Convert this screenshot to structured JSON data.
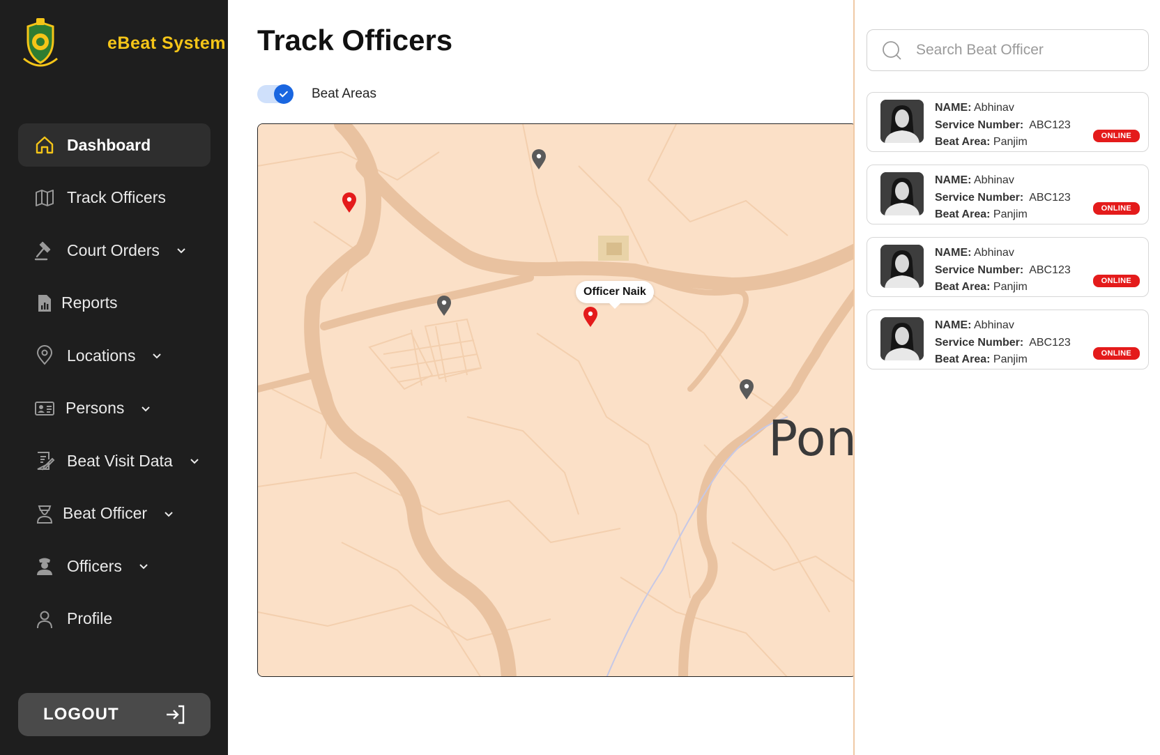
{
  "app": {
    "brand_title": "eBeat System",
    "brand_logo": "emblem-icon"
  },
  "sidebar": {
    "items": [
      {
        "label": "Dashboard",
        "icon": "home-icon",
        "active": true,
        "has_chevron": false
      },
      {
        "label": "Track Officers",
        "icon": "map-icon",
        "active": false,
        "has_chevron": false
      },
      {
        "label": "Court Orders",
        "icon": "gavel-icon",
        "active": false,
        "has_chevron": true
      },
      {
        "label": "Reports",
        "icon": "report-icon",
        "active": false,
        "has_chevron": false
      },
      {
        "label": "Locations",
        "icon": "location-icon",
        "active": false,
        "has_chevron": true
      },
      {
        "label": "Persons",
        "icon": "id-card-icon",
        "active": false,
        "has_chevron": true
      },
      {
        "label": "Beat Visit Data",
        "icon": "edit-document-icon",
        "active": false,
        "has_chevron": true
      },
      {
        "label": "Beat Officer",
        "icon": "officer-icon",
        "active": false,
        "has_chevron": true
      },
      {
        "label": "Officers",
        "icon": "police-icon",
        "active": false,
        "has_chevron": true
      },
      {
        "label": "Profile",
        "icon": "user-icon",
        "active": false,
        "has_chevron": false
      }
    ],
    "logout_label": "LOGOUT",
    "logout_icon": "logout-icon"
  },
  "main": {
    "title": "Track Officers",
    "toggle": {
      "label": "Beat Areas",
      "checked": true
    },
    "map": {
      "tooltip": "Officer Naik",
      "city_label": "Pon",
      "pins": [
        {
          "color": "#e41b1b",
          "kind": "officer"
        },
        {
          "color": "#5a5a5a",
          "kind": "location"
        },
        {
          "color": "#5a5a5a",
          "kind": "location"
        },
        {
          "color": "#e41b1b",
          "kind": "officer",
          "selected": true
        },
        {
          "color": "#5a5a5a",
          "kind": "location"
        }
      ]
    }
  },
  "panel": {
    "search_placeholder": "Search Beat Officer",
    "cards": [
      {
        "name_label": "NAME:",
        "name": "Abhinav",
        "service_label": "Service Number:",
        "service": "ABC123",
        "area_label": "Beat Area:",
        "area": "Panjim",
        "status": "ONLINE"
      },
      {
        "name_label": "NAME:",
        "name": "Abhinav",
        "service_label": "Service Number:",
        "service": "ABC123",
        "area_label": "Beat Area:",
        "area": "Panjim",
        "status": "ONLINE"
      },
      {
        "name_label": "NAME:",
        "name": "Abhinav",
        "service_label": "Service Number:",
        "service": "ABC123",
        "area_label": "Beat Area:",
        "area": "Panjim",
        "status": "ONLINE"
      },
      {
        "name_label": "NAME:",
        "name": "Abhinav",
        "service_label": "Service Number:",
        "service": "ABC123",
        "area_label": "Beat Area:",
        "area": "Panjim",
        "status": "ONLINE"
      }
    ]
  },
  "colors": {
    "sidebar_bg": "#1e1e1e",
    "brand": "#f5c518",
    "accent": "#1a66e0",
    "online": "#e41b1b",
    "map_bg": "#fbe0c7",
    "road": "#e9c2a0"
  }
}
